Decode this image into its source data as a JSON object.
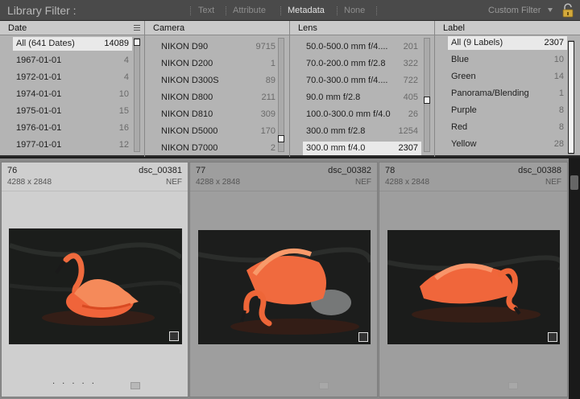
{
  "filterbar": {
    "title": "Library Filter :",
    "modes": [
      "Text",
      "Attribute",
      "Metadata",
      "None"
    ],
    "active_mode": "Metadata",
    "preset": "Custom Filter",
    "lock_icon": "lock-icon"
  },
  "columns": {
    "date": {
      "header": "Date",
      "rows": [
        {
          "label": "All (641 Dates)",
          "count": "14089",
          "selected": true
        },
        {
          "label": "1967-01-01",
          "count": "4"
        },
        {
          "label": "1972-01-01",
          "count": "4"
        },
        {
          "label": "1974-01-01",
          "count": "10"
        },
        {
          "label": "1975-01-01",
          "count": "15"
        },
        {
          "label": "1976-01-01",
          "count": "16"
        },
        {
          "label": "1977-01-01",
          "count": "12"
        }
      ]
    },
    "camera": {
      "header": "Camera",
      "rows": [
        {
          "label": "NIKON D90",
          "count": "9715"
        },
        {
          "label": "NIKON D200",
          "count": "1"
        },
        {
          "label": "NIKON D300S",
          "count": "89"
        },
        {
          "label": "NIKON D800",
          "count": "211"
        },
        {
          "label": "NIKON D810",
          "count": "309"
        },
        {
          "label": "NIKON D5000",
          "count": "170"
        },
        {
          "label": "NIKON D7000",
          "count": "2"
        }
      ]
    },
    "lens": {
      "header": "Lens",
      "rows": [
        {
          "label": "50.0-500.0 mm f/4....",
          "count": "201"
        },
        {
          "label": "70.0-200.0 mm f/2.8",
          "count": "322"
        },
        {
          "label": "70.0-300.0 mm f/4....",
          "count": "722"
        },
        {
          "label": "90.0 mm f/2.8",
          "count": "405"
        },
        {
          "label": "100.0-300.0 mm f/4.0",
          "count": "26"
        },
        {
          "label": "300.0 mm f/2.8",
          "count": "1254"
        },
        {
          "label": "300.0 mm f/4.0",
          "count": "2307",
          "selected": true
        }
      ]
    },
    "label": {
      "header": "Label",
      "rows": [
        {
          "label": "All (9 Labels)",
          "count": "2307",
          "selected": true
        },
        {
          "label": "Blue",
          "count": "10"
        },
        {
          "label": "Green",
          "count": "14"
        },
        {
          "label": "Panorama/Blending",
          "count": "1"
        },
        {
          "label": "Purple",
          "count": "8"
        },
        {
          "label": "Red",
          "count": "8"
        },
        {
          "label": "Yellow",
          "count": "28"
        }
      ]
    }
  },
  "grid": {
    "cells": [
      {
        "index": "76",
        "filename": "dsc_00381",
        "dimensions": "4288 x 2848",
        "format": "NEF",
        "selected": true
      },
      {
        "index": "77",
        "filename": "dsc_00382",
        "dimensions": "4288 x 2848",
        "format": "NEF"
      },
      {
        "index": "78",
        "filename": "dsc_00388",
        "dimensions": "4288 x 2848",
        "format": "NEF"
      }
    ]
  },
  "colors": {
    "panel_bg": "#b4b4b4",
    "selected_row": "#e9e9e9",
    "grid_bg": "#8a8a8a",
    "selected_cell": "#cfcfcf",
    "flamingo": "#f0643a"
  }
}
